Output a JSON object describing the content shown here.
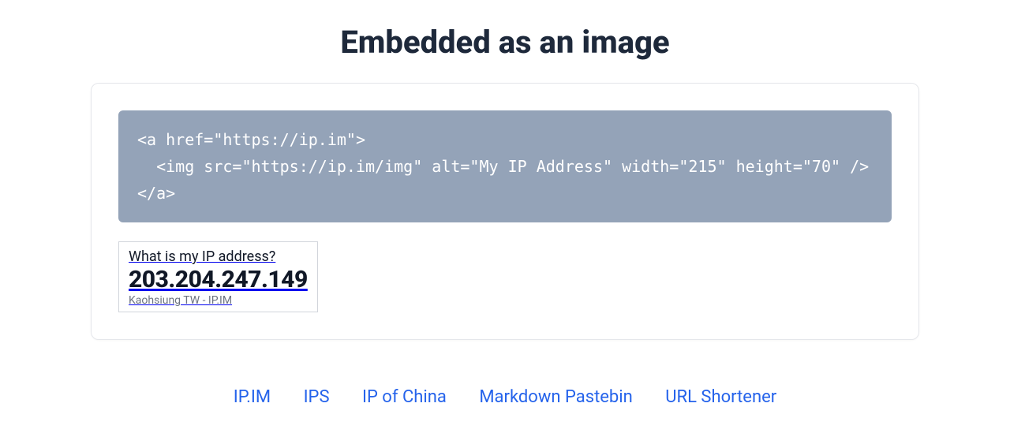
{
  "title": "Embedded as an image",
  "code_snippet": "<a href=\"https://ip.im\">\n  <img src=\"https://ip.im/img\" alt=\"My IP Address\" width=\"215\" height=\"70\" />\n</a>",
  "ip_widget": {
    "question": "What is my IP address?",
    "ip": "203.204.247.149",
    "location": "Kaohsiung TW - IP.IM"
  },
  "footer": {
    "links": [
      "IP.IM",
      "IPS",
      "IP of China",
      "Markdown Pastebin",
      "URL Shortener"
    ]
  }
}
